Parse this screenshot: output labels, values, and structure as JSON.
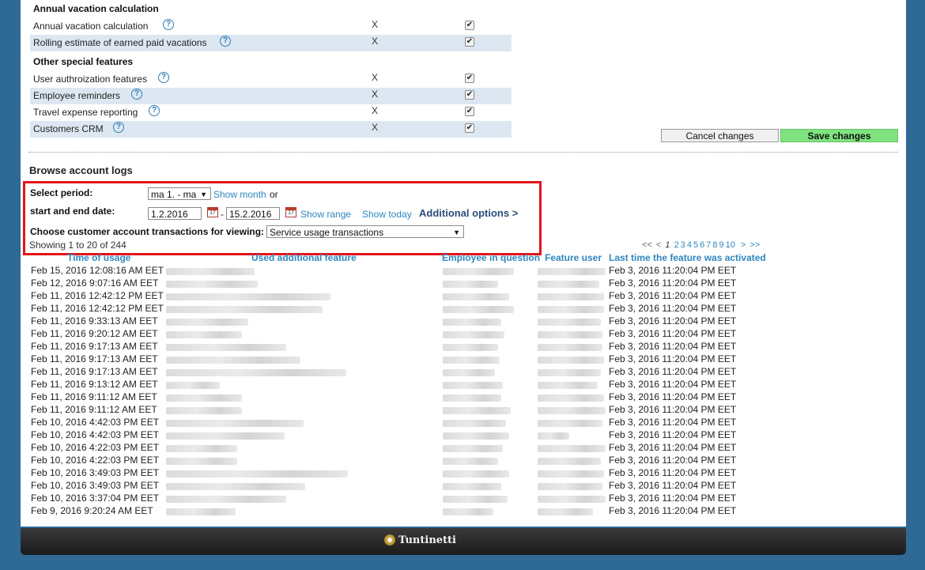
{
  "features": {
    "sections": [
      {
        "title": "Annual vacation calculation",
        "items": [
          {
            "label": "Annual vacation calculation",
            "x": "X",
            "checked": true
          },
          {
            "label": "Rolling estimate of earned paid vacations",
            "x": "X",
            "checked": true
          }
        ]
      },
      {
        "title": "Other special features",
        "items": [
          {
            "label": "User authroization features",
            "x": "X",
            "checked": true
          },
          {
            "label": "Employee reminders",
            "x": "X",
            "checked": true
          },
          {
            "label": "Travel expense reporting",
            "x": "X",
            "checked": true
          },
          {
            "label": "Customers CRM",
            "x": "X",
            "checked": true
          }
        ]
      }
    ],
    "help_glyph": "?",
    "check_glyph": "✔"
  },
  "buttons": {
    "cancel": "Cancel changes",
    "save": "Save changes"
  },
  "logs": {
    "title": "Browse account logs",
    "select_period_label": "Select period:",
    "period_value": "ma 1. - ma",
    "show_month": "Show month",
    "or": "or",
    "start_end_label": "start and end date:",
    "start_date": "1.2.2016",
    "date_sep": "-",
    "end_date": "15.2.2016",
    "cal_glyph": "17",
    "show_range": "Show range",
    "show_today": "Show today",
    "additional_options": "Additional options >",
    "transactions_label": "Choose customer account transactions for viewing:",
    "transactions_value": "Service usage transactions",
    "showing": "Showing 1 to 20 of 244",
    "pager": {
      "first": "<<",
      "prev": "<",
      "current": "1",
      "pages": [
        "2",
        "3",
        "4",
        "5",
        "6",
        "7",
        "8",
        "9",
        "10"
      ],
      "next": ">",
      "last": ">>"
    },
    "headers": {
      "time": "Time of usage",
      "feature": "Used additional feature",
      "employee": "Employee in question",
      "user": "Feature user",
      "activated": "Last time the feature was activated"
    },
    "rows": [
      {
        "time": "Feb 15, 2016 12:08:16 AM EET",
        "activated": "Feb 3, 2016 11:20:04 PM EET"
      },
      {
        "time": "Feb 12, 2016 9:07:16 AM EET",
        "activated": "Feb 3, 2016 11:20:04 PM EET"
      },
      {
        "time": "Feb 11, 2016 12:42:12 PM EET",
        "activated": "Feb 3, 2016 11:20:04 PM EET"
      },
      {
        "time": "Feb 11, 2016 12:42:12 PM EET",
        "activated": "Feb 3, 2016 11:20:04 PM EET"
      },
      {
        "time": "Feb 11, 2016 9:33:13 AM EET",
        "activated": "Feb 3, 2016 11:20:04 PM EET"
      },
      {
        "time": "Feb 11, 2016 9:20:12 AM EET",
        "activated": "Feb 3, 2016 11:20:04 PM EET"
      },
      {
        "time": "Feb 11, 2016 9:17:13 AM EET",
        "activated": "Feb 3, 2016 11:20:04 PM EET"
      },
      {
        "time": "Feb 11, 2016 9:17:13 AM EET",
        "activated": "Feb 3, 2016 11:20:04 PM EET"
      },
      {
        "time": "Feb 11, 2016 9:17:13 AM EET",
        "activated": "Feb 3, 2016 11:20:04 PM EET"
      },
      {
        "time": "Feb 11, 2016 9:13:12 AM EET",
        "activated": "Feb 3, 2016 11:20:04 PM EET"
      },
      {
        "time": "Feb 11, 2016 9:11:12 AM EET",
        "activated": "Feb 3, 2016 11:20:04 PM EET"
      },
      {
        "time": "Feb 11, 2016 9:11:12 AM EET",
        "activated": "Feb 3, 2016 11:20:04 PM EET"
      },
      {
        "time": "Feb 10, 2016 4:42:03 PM EET",
        "activated": "Feb 3, 2016 11:20:04 PM EET"
      },
      {
        "time": "Feb 10, 2016 4:42:03 PM EET",
        "activated": "Feb 3, 2016 11:20:04 PM EET"
      },
      {
        "time": "Feb 10, 2016 4:22:03 PM EET",
        "activated": "Feb 3, 2016 11:20:04 PM EET"
      },
      {
        "time": "Feb 10, 2016 4:22:03 PM EET",
        "activated": "Feb 3, 2016 11:20:04 PM EET"
      },
      {
        "time": "Feb 10, 2016 3:49:03 PM EET",
        "activated": "Feb 3, 2016 11:20:04 PM EET"
      },
      {
        "time": "Feb 10, 2016 3:49:03 PM EET",
        "activated": "Feb 3, 2016 11:20:04 PM EET"
      },
      {
        "time": "Feb 10, 2016 3:37:04 PM EET",
        "activated": "Feb 3, 2016 11:20:04 PM EET"
      },
      {
        "time": "Feb 9, 2016 9:20:24 AM EET",
        "activated": "Feb 3, 2016 11:20:04 PM EET"
      }
    ]
  },
  "footer": {
    "brand": "Tuntinetti"
  }
}
